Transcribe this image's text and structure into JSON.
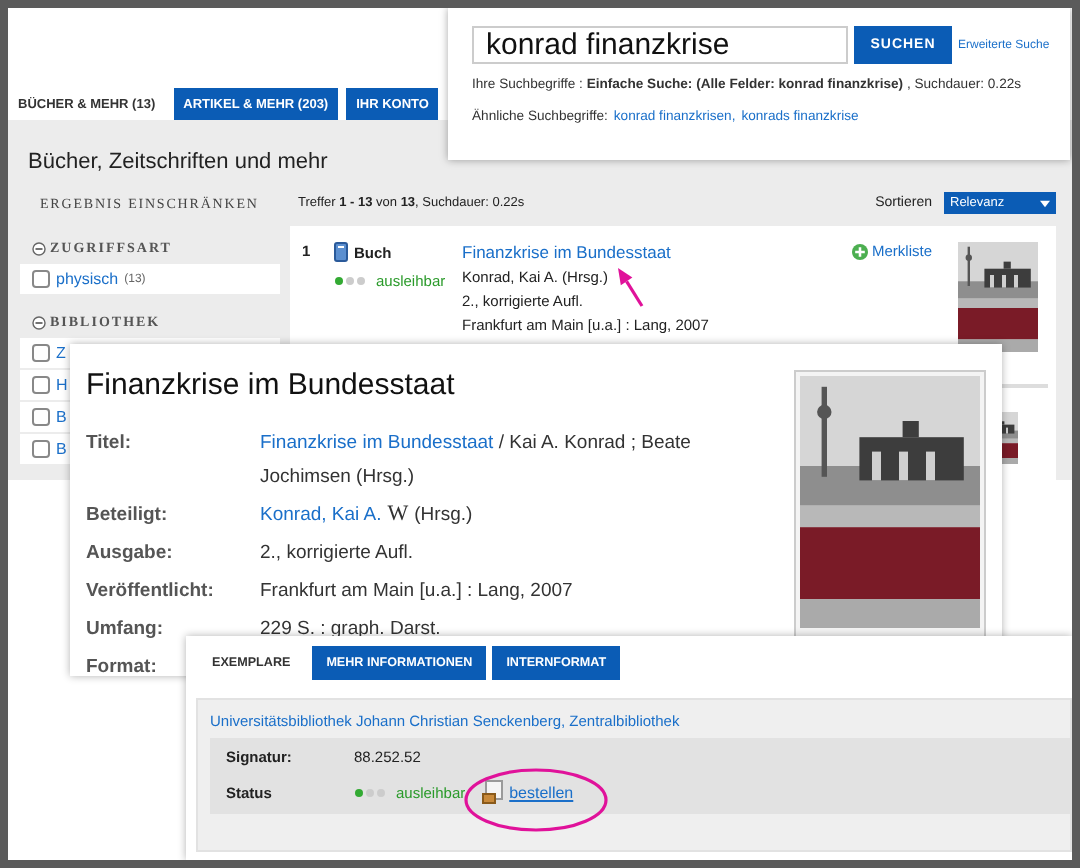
{
  "search_panel": {
    "query": "konrad finanzkrise",
    "button": "SUCHEN",
    "advanced_link": "Erweiterte Suche",
    "summary": "Ihre Suchbegriffe : **Einfache Suche: (Alle Felder: konrad finanzkrise)** , Suchdauer: 0.22s",
    "similar_label": "Ähnliche Suchbegriffe:",
    "similar_links": [
      "konrad finanzkrisen,",
      "konrads finanzkrise"
    ]
  },
  "results_page": {
    "tabs": [
      {
        "label": "BÜCHER & MEHR",
        "count": "(13)",
        "selected": true
      },
      {
        "label": "ARTIKEL & MEHR",
        "count": "(203)",
        "selected": false
      },
      {
        "label": "IHR KONTO",
        "selected": false
      }
    ],
    "heading": "Bücher, Zeitschriften und mehr",
    "filter_title": "ERGEBNIS EINSCHRÄNKEN",
    "facets": [
      {
        "title": "ZUGRIFFSART",
        "options": [
          {
            "label": "physisch",
            "count": "(13)",
            "checked": false
          }
        ]
      },
      {
        "title": "BIBLIOTHEK",
        "options": [
          {
            "label": "Z",
            "checked": false
          },
          {
            "label": "H",
            "checked": false
          },
          {
            "label": "B",
            "checked": false
          },
          {
            "label": "B",
            "checked": false
          }
        ]
      }
    ],
    "hits_summary": "Treffer **1 - 13** von **13**, Suchdauer: 0.22s",
    "sort_label": "Sortieren",
    "sort_value": "Relevanz",
    "results": [
      {
        "number": "1",
        "type": "Buch",
        "availability": "ausleihbar",
        "title": "Finanzkrise im Bundesstaat",
        "lines": [
          "Konrad, Kai A. (Hrsg.)",
          "2., korrigierte Aufl.",
          "Frankfurt am Main [u.a.] : Lang, 2007"
        ],
        "watchlist": "Merkliste"
      }
    ]
  },
  "detail": {
    "title": "Finanzkrise im Bundesstaat",
    "fields": [
      {
        "label": "Titel:",
        "link": "Finanzkrise im Bundesstaat",
        "text": " / Kai A. Konrad ; Beate Jochimsen (Hrsg.)"
      },
      {
        "label": "Beteiligt:",
        "link": "Konrad, Kai A.",
        "badge": "W",
        "text": "(Hrsg.)"
      },
      {
        "label": "Ausgabe:",
        "text": "2., korrigierte Aufl."
      },
      {
        "label": "Veröffentlicht:",
        "text": "Frankfurt am Main [u.a.] : Lang, 2007"
      },
      {
        "label": "Umfang:",
        "text": "229 S. : graph. Darst."
      },
      {
        "label": "Format:"
      }
    ]
  },
  "holdings": {
    "tabs": [
      {
        "label": "EXEMPLARE",
        "selected": true
      },
      {
        "label": "MEHR INFORMATIONEN",
        "selected": false
      },
      {
        "label": "INTERNFORMAT",
        "selected": false
      }
    ],
    "library": "Universitätsbibliothek Johann Christian Senckenberg, Zentralbibliothek",
    "signature_label": "Signatur:",
    "signature": "88.252.52",
    "status_label": "Status",
    "availability": "ausleihbar",
    "order_link": "bestellen"
  }
}
